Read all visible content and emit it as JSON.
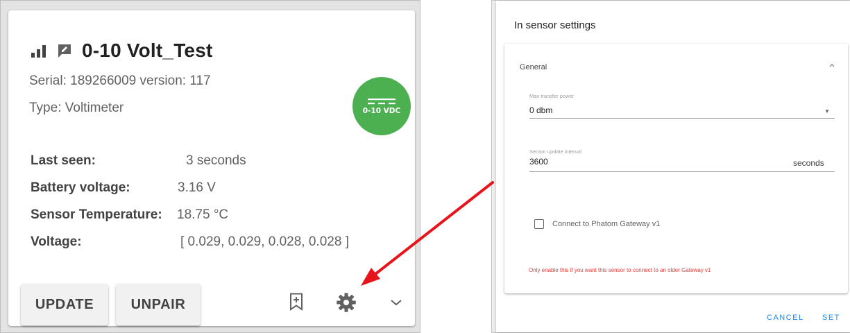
{
  "device_card": {
    "title": "0-10 Volt_Test",
    "serial_line": "Serial: 189266009 version: 117",
    "type_line": "Type: Voltimeter",
    "badge_text": "0-10 VDC",
    "badge_color": "#4caf50",
    "info_rows": [
      {
        "label": "Last seen:",
        "value": "3 seconds"
      },
      {
        "label": "Battery voltage:",
        "value": "3.16 V"
      },
      {
        "label": "Sensor Temperature:",
        "value": "18.75 °C"
      },
      {
        "label": "Voltage:",
        "value": "[ 0.029, 0.029, 0.028, 0.028 ]"
      }
    ],
    "buttons": {
      "update": "UPDATE",
      "unpair": "UNPAIR"
    },
    "icons": [
      "signal-icon",
      "chat-edit-icon",
      "bookmark-add-icon",
      "gear-icon",
      "chevron-down-icon"
    ]
  },
  "settings_dialog": {
    "title": "In sensor settings",
    "panel_title": "General",
    "fields": [
      {
        "label": "Max transfer power",
        "value": "0 dbm"
      },
      {
        "label": "Sensor update interval",
        "value": "3600",
        "suffix": "seconds"
      }
    ],
    "checkbox_label": "Connect to Phatom Gateway v1",
    "warning": "Only enable this if you want this sensor to connect to an older Gateway v1",
    "warning_color": "#e53935",
    "actions": {
      "cancel": "CANCEL",
      "set": "SET"
    },
    "action_color": "#1e88e5"
  },
  "annotation": {
    "arrow_color": "#e8141b"
  }
}
